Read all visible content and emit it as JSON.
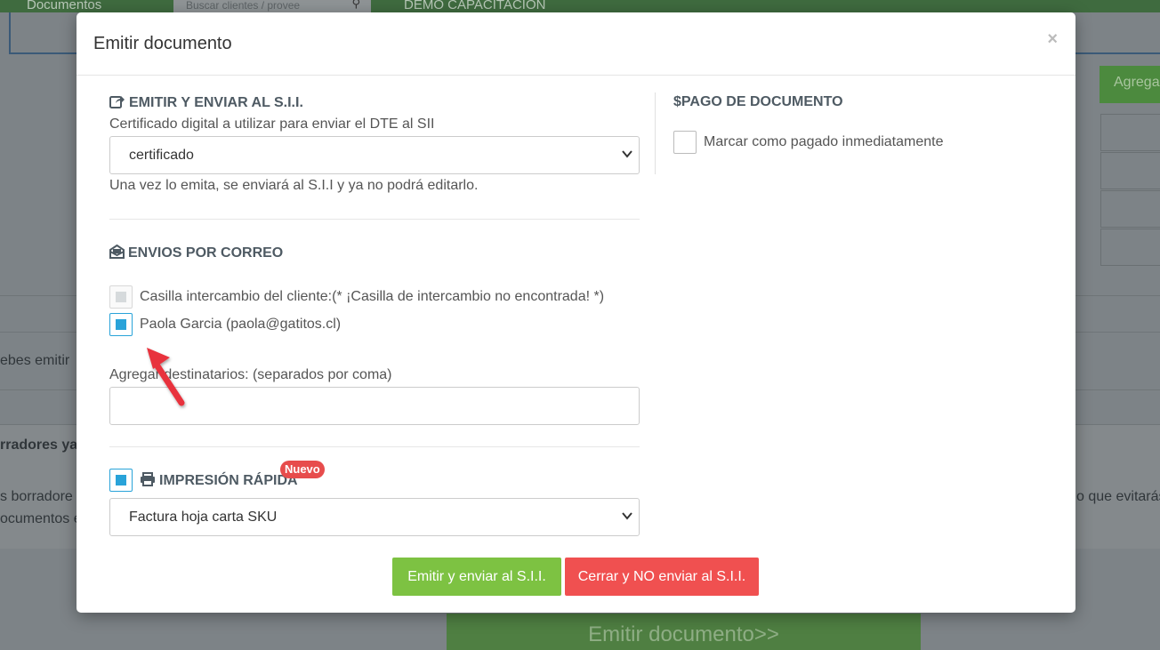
{
  "background": {
    "menu_documentos": "Documentos",
    "search_placeholder": "Buscar clientes / provee",
    "company": "DEMO CAPACITACION",
    "add_button": "Agrega",
    "text_left_1": "ebes emitir",
    "text_left_2": "rradores ya",
    "text_left_3": "s borradore",
    "text_left_4": "ocumentos e",
    "text_right": "o que evitarás",
    "emit_button": "Emitir documento>>"
  },
  "modal": {
    "title": "Emitir documento",
    "close": "×",
    "sii": {
      "title": "EMITIR Y ENVIAR AL S.I.I.",
      "cert_label": "Certificado digital a utilizar para enviar el DTE al SII",
      "cert_selected": "certificado",
      "note": "Una vez lo emita, se enviará al S.I.I y ya no podrá editarlo."
    },
    "payment": {
      "title": "$PAGO DE DOCUMENTO",
      "mark_paid_label": "Marcar como pagado inmediatamente"
    },
    "email": {
      "title": "ENVIOS POR CORREO",
      "exchange_label": "Casilla intercambio del cliente:(* ¡Casilla de intercambio no encontrada! *)",
      "contact_label": "Paola Garcia (paola@gatitos.cl)",
      "extra_label": "Agregar destinatarios: (separados por coma)",
      "extra_value": ""
    },
    "print": {
      "title": "IMPRESIÓN RÁPIDA",
      "badge": "Nuevo",
      "format_selected": "Factura hoja carta SKU"
    },
    "buttons": {
      "emit": "Emitir y enviar al S.I.I.",
      "close_no_send": "Cerrar y NO enviar al S.I.I."
    }
  },
  "colors": {
    "accent_blue": "#29a3d9",
    "button_green": "#7dc242",
    "button_red": "#f05050",
    "annotation_arrow": "#e8323c"
  }
}
